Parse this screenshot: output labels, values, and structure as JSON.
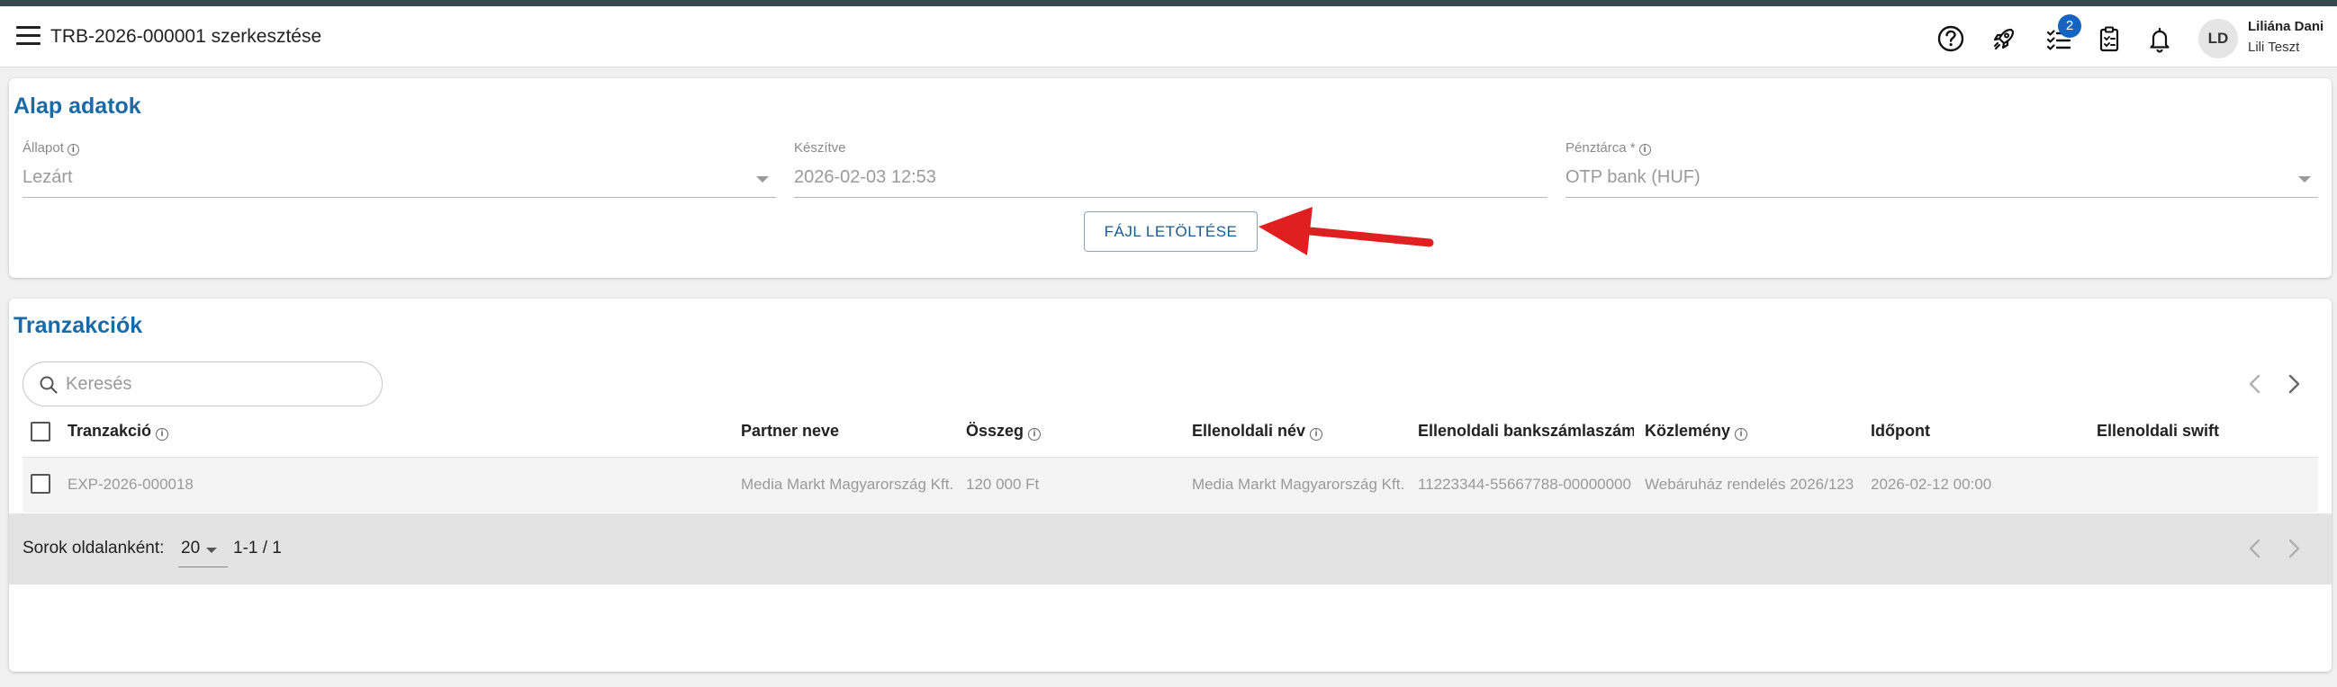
{
  "header": {
    "title": "TRB-2026-000001 szerkesztése",
    "notification_count": "2",
    "user_initials": "LD",
    "user_name": "Liliána Dani",
    "user_org": "Lili Teszt",
    "icons": [
      "help-icon",
      "rocket-icon",
      "tasks-icon",
      "clipboard-icon",
      "bell-icon"
    ]
  },
  "basic": {
    "title": "Alap adatok",
    "status_label": "Állapot",
    "status_value": "Lezárt",
    "created_label": "Készítve",
    "created_value": "2026-02-03 12:53",
    "wallet_label": "Pénztárca *",
    "wallet_value": "OTP bank (HUF)",
    "download_label": "FÁJL LETÖLTÉSE"
  },
  "transactions": {
    "title": "Tranzakciók",
    "search_placeholder": "Keresés",
    "columns": [
      "Tranzakció",
      "Partner neve",
      "Összeg",
      "Ellenoldali név",
      "Ellenoldali bankszámlaszám",
      "Közlemény",
      "Időpont",
      "Ellenoldali swift"
    ],
    "rows": [
      {
        "tranzakcio": "EXP-2026-000018",
        "partner": "Media Markt Magyarország Kft.",
        "osszeg": "120 000 Ft",
        "ellen_nev": "Media Markt Magyarország Kft.",
        "ellen_szamla": "11223344-55667788-00000000",
        "kozlemeny": "Webáruház rendelés 2026/123",
        "idopont": "2026-02-12 00:00",
        "swift": ""
      }
    ],
    "rows_per_page_label": "Sorok oldalanként:",
    "rows_per_page": "20",
    "range": "1-1 / 1"
  },
  "colors": {
    "accent": "#1a6aa6",
    "top_strip": "#37474f",
    "badge": "#1565c0",
    "annotation_arrow": "#e02020"
  }
}
